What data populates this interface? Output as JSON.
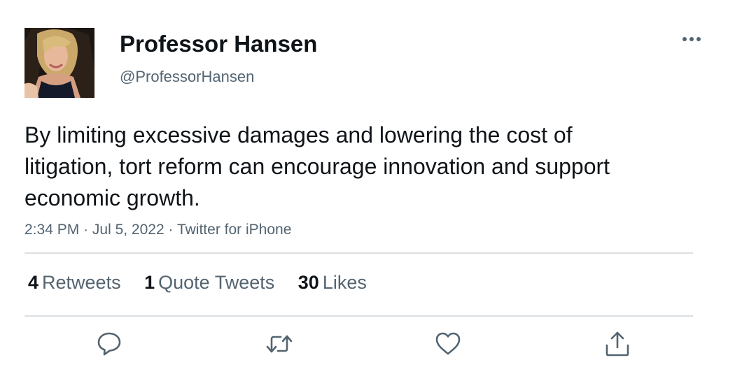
{
  "tweet": {
    "author": {
      "display_name": "Professor Hansen",
      "handle": "@ProfessorHansen"
    },
    "text": "By limiting excessive damages and lowering the cost of litigation, tort reform can encourage innovation and support economic growth.",
    "time": "2:34 PM",
    "date": "Jul 5, 2022",
    "source": "Twitter for iPhone",
    "separator": "·"
  },
  "stats": {
    "retweets": {
      "count": "4",
      "label": "Retweets"
    },
    "quotes": {
      "count": "1",
      "label": "Quote Tweets"
    },
    "likes": {
      "count": "30",
      "label": "Likes"
    }
  },
  "icons": {
    "more": "more-horizontal-icon",
    "reply": "reply-icon",
    "retweet": "retweet-icon",
    "like": "heart-icon",
    "share": "share-icon"
  },
  "colors": {
    "text_primary": "#0f1419",
    "text_secondary": "#536471",
    "divider": "#dcdfe2"
  }
}
